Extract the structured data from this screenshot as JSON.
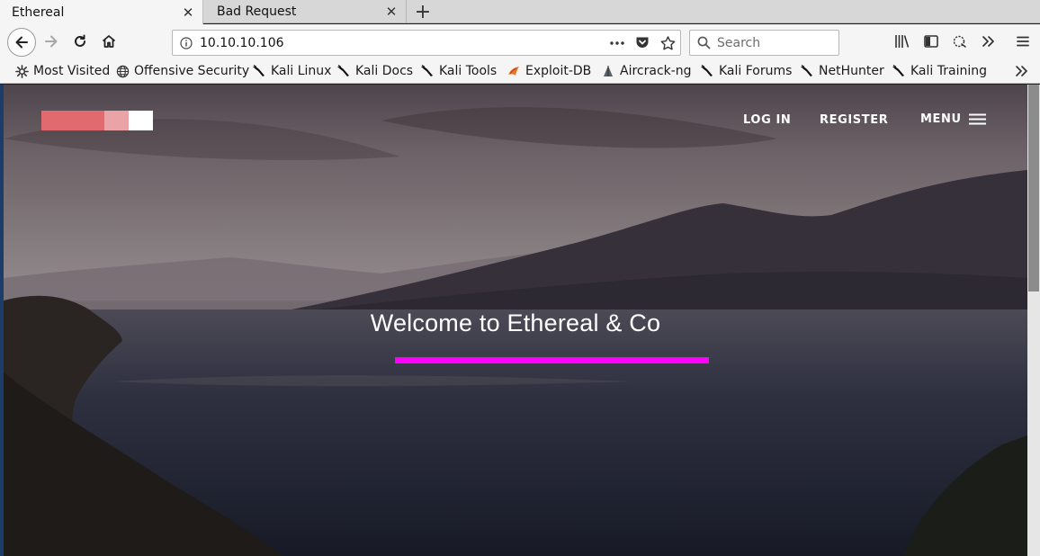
{
  "tabs": [
    {
      "title": "Ethereal",
      "active": true
    },
    {
      "title": "Bad Request",
      "active": false
    }
  ],
  "toolbar": {
    "url": "10.10.10.106",
    "search_placeholder": "Search"
  },
  "bookmarks": [
    {
      "label": "Most Visited",
      "icon": "gear-icon"
    },
    {
      "label": "Offensive Security",
      "icon": "globe-icon"
    },
    {
      "label": "Kali Linux",
      "icon": "kali-dragon-icon"
    },
    {
      "label": "Kali Docs",
      "icon": "kali-dragon-icon"
    },
    {
      "label": "Kali Tools",
      "icon": "kali-dragon-icon"
    },
    {
      "label": "Exploit-DB",
      "icon": "exploit-db-icon"
    },
    {
      "label": "Aircrack-ng",
      "icon": "aircrack-icon"
    },
    {
      "label": "Kali Forums",
      "icon": "kali-dragon-icon"
    },
    {
      "label": "NetHunter",
      "icon": "kali-dragon-icon"
    },
    {
      "label": "Kali Training",
      "icon": "kali-dragon-icon"
    }
  ],
  "site": {
    "nav": {
      "login": "LOG IN",
      "register": "REGISTER",
      "menu": "MENU"
    },
    "hero_title": "Welcome to Ethereal & Co",
    "colors": {
      "logo_red": "#e06a6d",
      "logo_pink": "#eaa3a6",
      "highlight": "#ff00ff"
    }
  }
}
